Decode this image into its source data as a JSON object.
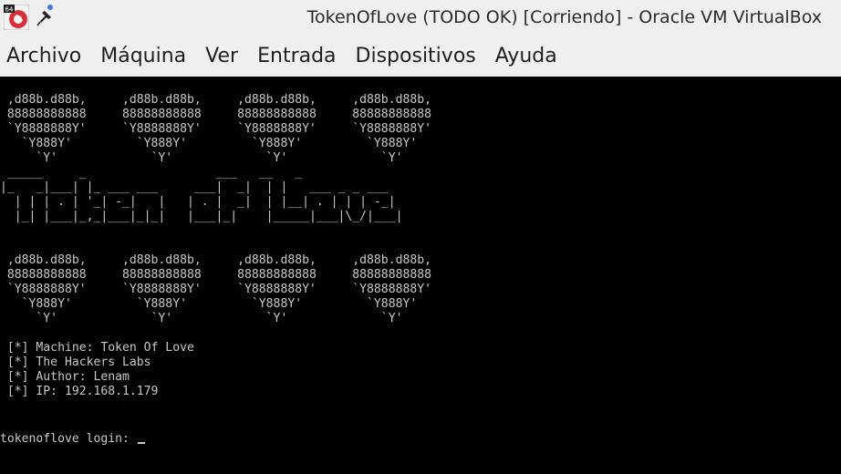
{
  "window": {
    "title": "TokenOfLove (TODO OK) [Corriendo] - Oracle VM VirtualBox",
    "app_icon_badge": "64"
  },
  "menu": {
    "items": [
      "Archivo",
      "Máquina",
      "Ver",
      "Entrada",
      "Dispositivos",
      "Ayuda"
    ]
  },
  "console": {
    "hearts_top": " ,d88b.d88b,     ,d88b.d88b,     ,d88b.d88b,     ,d88b.d88b,\n 88888888888     88888888888     88888888888     88888888888\n `Y8888888Y'     `Y8888888Y'     `Y8888888Y'     `Y8888888Y'\n   `Y888Y'         `Y888Y'         `Y888Y'         `Y888Y'\n     `Y'             `Y'             `Y'             `Y'",
    "logo": " _____     _                  ___   __   _\n|_   _|___| |_ ___ ___     ___|  _|  | |   ___ _ _ ___\n  | | | . | '_| -_|   |   | . |  _|  | |__| . | | | -_|\n  |_| |___|_,_|___|_|_|   |___|_|    |_____|___|\\_/|___|",
    "hearts_bottom": " ,d88b.d88b,     ,d88b.d88b,     ,d88b.d88b,     ,d88b.d88b,\n 88888888888     88888888888     88888888888     88888888888\n `Y8888888Y'     `Y8888888Y'     `Y8888888Y'     `Y8888888Y'\n   `Y888Y'         `Y888Y'         `Y888Y'         `Y888Y'\n     `Y'             `Y'             `Y'             `Y'",
    "info_lines": [
      " [*] Machine: Token Of Love",
      " [*] The Hackers Labs",
      " [*] Author: Lenam",
      " [*] IP: 192.168.1.179"
    ],
    "login_prompt": "tokenoflove login: "
  },
  "colors": {
    "chrome_bg": "#efefef",
    "console_bg": "#000000",
    "console_fg": "#c8c8c8",
    "icon_red": "#d8303a"
  }
}
